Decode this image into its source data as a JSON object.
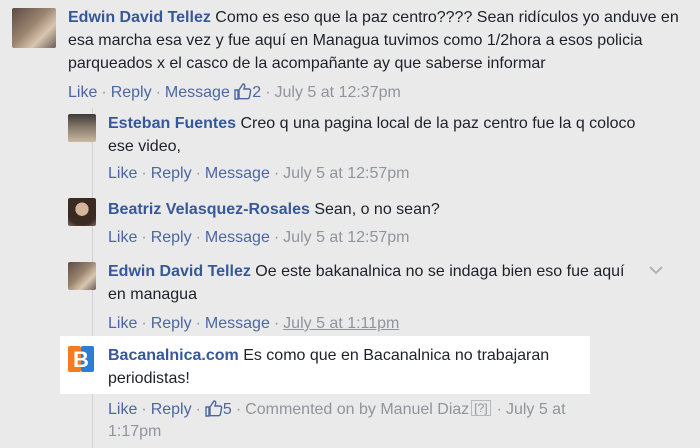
{
  "comments": [
    {
      "author": "Edwin David Tellez",
      "text": "Como es eso que la paz centro???? Sean ridículos yo anduve en esa marcha esa vez y fue aquí en Managua tuvimos como 1/2hora a esos policia parqueados x el casco de la acompañante ay que saberse informar",
      "like": "Like",
      "reply": "Reply",
      "message": "Message",
      "likes": "2",
      "time": "July 5 at 12:37pm"
    },
    {
      "author": "Esteban Fuentes",
      "text": "Creo q una pagina local de la paz centro fue la q coloco ese video,",
      "like": "Like",
      "reply": "Reply",
      "message": "Message",
      "time": "July 5 at 12:57pm"
    },
    {
      "author": "Beatriz Velasquez-Rosales",
      "text": "Sean, o no sean?",
      "like": "Like",
      "reply": "Reply",
      "message": "Message",
      "time": "July 5 at 12:57pm"
    },
    {
      "author": "Edwin David Tellez",
      "text": "Oe este bakanalnica no se indaga bien eso fue aquí en managua",
      "like": "Like",
      "reply": "Reply",
      "message": "Message",
      "time": "July 5 at 1:11pm"
    },
    {
      "author": "Bacanalnica.com",
      "text": "Es como que en Bacanalnica no trabajaran periodistas!",
      "like": "Like",
      "reply": "Reply",
      "likes": "5",
      "commented_on": "Commented on by Manuel Diaz",
      "help": "[?]",
      "time": "July 5 at",
      "time2": "1:17pm"
    }
  ],
  "icons": {
    "like": "thumbs-up-icon",
    "menu": "chevron-down-icon",
    "page_logo": "bacanalnica-logo-icon"
  },
  "colors": {
    "name": "#365899",
    "meta": "#90949c",
    "link": "#4b67a1",
    "logo_orange": "#f47b20",
    "logo_blue": "#2a7fd4"
  }
}
